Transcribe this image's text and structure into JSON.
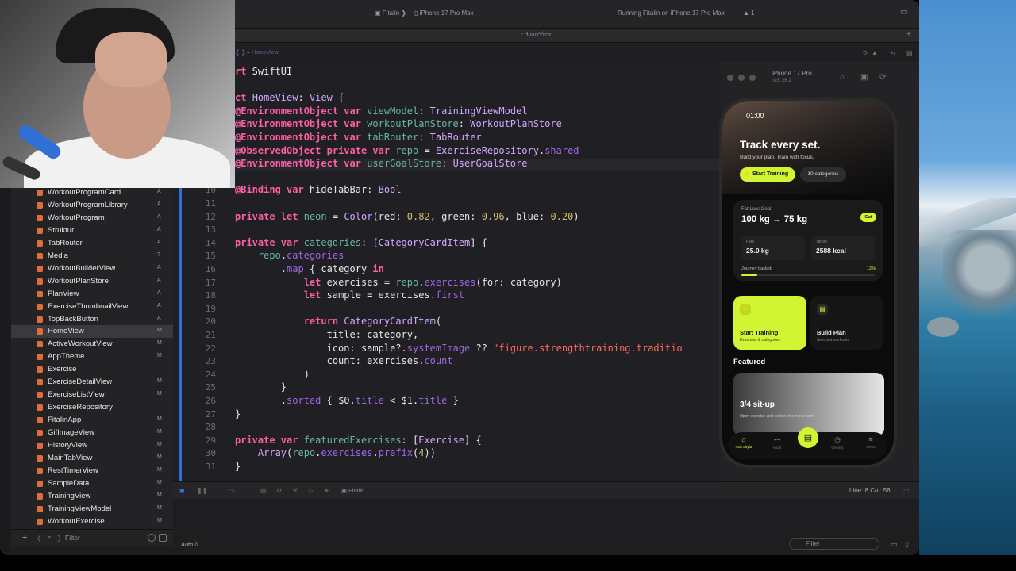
{
  "titlebar": {
    "scheme": "Fitalin",
    "device": "iPhone 17 Pro Max",
    "status": "Running Fitalin on iPhone 17 Pro Max",
    "warnings": "1"
  },
  "tab": {
    "active": "HomeView"
  },
  "jumpbar": {
    "crumb": "HomeView"
  },
  "navigator": {
    "items": [
      {
        "label": "WorkoutProgramCard",
        "status": "A"
      },
      {
        "label": "WorkoutProgramLibrary",
        "status": "A"
      },
      {
        "label": "WorkoutProgram",
        "status": "A"
      },
      {
        "label": "Struktur",
        "status": "A"
      },
      {
        "label": "TabRouter",
        "status": "A"
      },
      {
        "label": "Media",
        "status": "?"
      },
      {
        "label": "WorkoutBuilderView",
        "status": "A"
      },
      {
        "label": "WorkoutPlanStore",
        "status": "A"
      },
      {
        "label": "PlanView",
        "status": "A"
      },
      {
        "label": "ExerciseThumbnailView",
        "status": "A"
      },
      {
        "label": "TopBackButton",
        "status": "A"
      },
      {
        "label": "HomeView",
        "status": "M"
      },
      {
        "label": "ActiveWorkoutView",
        "status": "M"
      },
      {
        "label": "AppTheme",
        "status": "M"
      },
      {
        "label": "Exercise",
        "status": ""
      },
      {
        "label": "ExerciseDetailView",
        "status": "M"
      },
      {
        "label": "ExerciseListView",
        "status": "M"
      },
      {
        "label": "ExerciseRepository",
        "status": ""
      },
      {
        "label": "FitalinApp",
        "status": "M"
      },
      {
        "label": "GifImageView",
        "status": "M"
      },
      {
        "label": "HistoryView",
        "status": "M"
      },
      {
        "label": "MainTabView",
        "status": "M"
      },
      {
        "label": "RestTimerView",
        "status": "M"
      },
      {
        "label": "SampleData",
        "status": "M"
      },
      {
        "label": "TrainingView",
        "status": "M"
      },
      {
        "label": "TrainingViewModel",
        "status": "M"
      },
      {
        "label": "WorkoutExercise",
        "status": "M"
      }
    ],
    "filter_placeholder": "Filter"
  },
  "editor": {
    "lines": [
      {
        "n": "",
        "html": "<span class=\"kw\">rt</span> SwiftUI"
      },
      {
        "n": "",
        "html": ""
      },
      {
        "n": "",
        "html": "<span class=\"kw\">ct</span> <span class=\"ty\">HomeView</span>: <span class=\"ty\">View</span> {"
      },
      {
        "n": "",
        "html": "<span class=\"kw\">@EnvironmentObject var</span> <span class=\"id\">viewModel</span>: <span class=\"ty\">TrainingViewModel</span>"
      },
      {
        "n": "",
        "html": "<span class=\"kw\">@EnvironmentObject var</span> <span class=\"id\">workoutPlanStore</span>: <span class=\"ty\">WorkoutPlanStore</span>"
      },
      {
        "n": "",
        "html": "<span class=\"kw\">@EnvironmentObject var</span> <span class=\"id\">tabRouter</span>: <span class=\"ty\">TabRouter</span>"
      },
      {
        "n": "",
        "html": "<span class=\"kw\">@ObservedObject private var</span> <span class=\"id\">repo</span> = <span class=\"ty\">ExerciseRepository</span>.<span class=\"pr\">shared</span>"
      },
      {
        "n": "",
        "html": "<span class=\"kw\">@EnvironmentObject var</span> <span class=\"id\">userGoalStore</span>: <span class=\"ty\">UserGoalStore</span>"
      },
      {
        "n": "",
        "html": ""
      },
      {
        "n": "10",
        "html": "<span class=\"kw\">@Binding var</span> hideTabBar: <span class=\"ty\">Bool</span>"
      },
      {
        "n": "11",
        "html": ""
      },
      {
        "n": "12",
        "html": "<span class=\"kw\">private let</span> <span class=\"id\">neon</span> = <span class=\"ty\">Color</span>(red: <span class=\"num\">0.82</span>, green: <span class=\"num\">0.96</span>, blue: <span class=\"num\">0.20</span>)"
      },
      {
        "n": "13",
        "html": ""
      },
      {
        "n": "14",
        "html": "<span class=\"kw\">private var</span> <span class=\"id\">categories</span>: [<span class=\"ty\">CategoryCardItem</span>] {"
      },
      {
        "n": "15",
        "html": "    <span class=\"id\">repo</span>.<span class=\"pr\">categories</span>"
      },
      {
        "n": "16",
        "html": "        .<span class=\"pr\">map</span> { category <span class=\"kw\">in</span>"
      },
      {
        "n": "17",
        "html": "            <span class=\"kw\">let</span> exercises = <span class=\"id\">repo</span>.<span class=\"pr\">exercises</span>(for: category)"
      },
      {
        "n": "18",
        "html": "            <span class=\"kw\">let</span> sample = exercises.<span class=\"pr\">first</span>"
      },
      {
        "n": "19",
        "html": ""
      },
      {
        "n": "20",
        "html": "            <span class=\"kw\">return</span> <span class=\"ty\">CategoryCardItem</span>("
      },
      {
        "n": "21",
        "html": "                title: category,"
      },
      {
        "n": "22",
        "html": "                icon: sample?.<span class=\"pr\">systemImage</span> ?? <span class=\"str\">\"figure.strengthtraining.traditio</span>"
      },
      {
        "n": "23",
        "html": "                count: exercises.<span class=\"pr\">count</span>"
      },
      {
        "n": "24",
        "html": "            )"
      },
      {
        "n": "25",
        "html": "        }"
      },
      {
        "n": "26",
        "html": "        .<span class=\"pr\">sorted</span> { $0.<span class=\"pr\">title</span> &lt; $1.<span class=\"pr\">title</span> }"
      },
      {
        "n": "27",
        "html": "}"
      },
      {
        "n": "28",
        "html": ""
      },
      {
        "n": "29",
        "html": "<span class=\"kw\">private var</span> <span class=\"id\">featuredExercises</span>: [<span class=\"ty\">Exercise</span>] {"
      },
      {
        "n": "30",
        "html": "    <span class=\"ty\">Array</span>(<span class=\"id\">repo</span>.<span class=\"pr\">exercises</span>.<span class=\"pr\">prefix</span>(<span class=\"num\">4</span>))"
      },
      {
        "n": "31",
        "html": "}"
      }
    ]
  },
  "debug": {
    "scheme": "Fitalin",
    "position": "Line: 8  Col: 56"
  },
  "console": {
    "mode": "Auto ◊",
    "filter_placeholder": "Filter"
  },
  "preview": {
    "device_name": "iPhone 17 Pro...",
    "os": "iOS 26.2"
  },
  "app": {
    "time": "01:00",
    "hero_title": "Track every set.",
    "hero_sub": "Build your plan. Train with focus.",
    "start_button": "Start Training",
    "categories_button": "10 categories",
    "goal_label": "Fat Loss Goal",
    "goal_value": "100 kg → 75 kg",
    "goal_badge": "Cut",
    "stat1_key": "Fark",
    "stat1_value": "25.0 kg",
    "stat2_key": "Target",
    "stat2_value": "2588 kcal",
    "journey_label": "Journey başladı",
    "journey_pct": "12%",
    "journey_progress": 0.12,
    "action1_title": "Start Training",
    "action1_sub": "Exercises & categories",
    "action2_title": "Build Plan",
    "action2_sub": "Selected workouts",
    "featured_title": "Featured",
    "featured_name": "3/4 sit-up",
    "featured_desc": "Open exercise and explore the movement",
    "tabs": [
      {
        "label": "Ana Sayfa",
        "icon": "home-icon"
      },
      {
        "label": "Hazır",
        "icon": "dumbbell-icon"
      },
      {
        "label": "Geçmiş",
        "icon": "clock-icon"
      },
      {
        "label": "Menu",
        "icon": "menu-icon"
      }
    ]
  },
  "colors": {
    "neon": "#d1f533",
    "accent": "#2f6fd6"
  }
}
